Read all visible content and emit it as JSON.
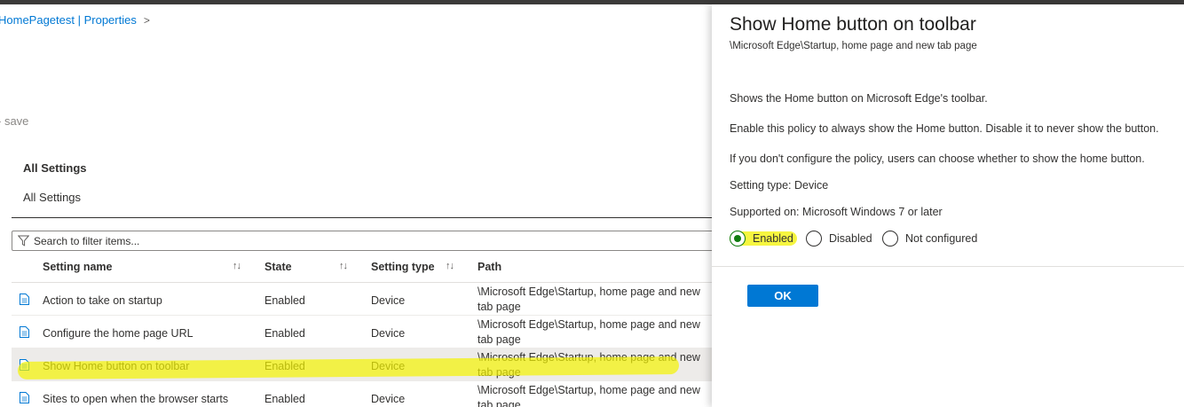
{
  "breadcrumb": {
    "label": "HomePagetest | Properties",
    "chevron": ">"
  },
  "toolbar": {
    "save_label": "- save"
  },
  "section": {
    "title": "All Settings",
    "subtitle": "All Settings"
  },
  "search": {
    "placeholder": "Search to filter items..."
  },
  "table": {
    "columns": [
      "Setting name",
      "State",
      "Setting type",
      "Path"
    ],
    "sort_glyph": "↑↓",
    "rows": [
      {
        "name": "Action to take on startup",
        "state": "Enabled",
        "type": "Device",
        "path": "\\Microsoft Edge\\Startup, home page and new tab page"
      },
      {
        "name": "Configure the home page URL",
        "state": "Enabled",
        "type": "Device",
        "path": "\\Microsoft Edge\\Startup, home page and new tab page"
      },
      {
        "name": "Show Home button on toolbar",
        "state": "Enabled",
        "type": "Device",
        "path": "\\Microsoft Edge\\Startup, home page and new tab page"
      },
      {
        "name": "Sites to open when the browser starts",
        "state": "Enabled",
        "type": "Device",
        "path": "\\Microsoft Edge\\Startup, home page and new tab page"
      }
    ],
    "selected_row": 2
  },
  "panel": {
    "title": "Show Home button on toolbar",
    "path": "\\Microsoft Edge\\Startup, home page and new tab page",
    "description": "Shows the Home button on Microsoft Edge's toolbar.",
    "enable_text": "Enable this policy to always show the Home button. Disable it to never show the button.",
    "unconfigured_text": "If you don't configure the policy, users can choose whether to show the home button.",
    "setting_type": "Setting type: Device",
    "supported_on": "Supported on: Microsoft Windows 7 or later",
    "options": [
      {
        "label": "Enabled",
        "checked": true
      },
      {
        "label": "Disabled",
        "checked": false
      },
      {
        "label": "Not configured",
        "checked": false
      }
    ],
    "ok_label": "OK"
  },
  "colors": {
    "accent": "#0078d4",
    "radio_checked": "#107c10",
    "highlight": "#f3f300"
  }
}
